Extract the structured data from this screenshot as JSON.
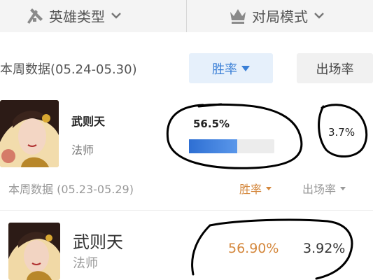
{
  "filters": {
    "hero_type": "英雄类型",
    "match_mode": "对局模式"
  },
  "section1": {
    "week_label": "本周数据(05.24-05.30)",
    "sort_winrate": "胜率",
    "sort_pickrate": "出场率",
    "hero": {
      "name": "武则天",
      "role": "法师",
      "win_rate_text": "56.5%",
      "win_rate_fraction": 0.565,
      "pick_rate_text": "3.7%"
    }
  },
  "section2": {
    "week_label": "本周数据 (05.23-05.29)",
    "sort_winrate": "胜率",
    "sort_pickrate": "出场率",
    "hero": {
      "name": "武则天",
      "role": "法师",
      "win_rate_text": "56.90%",
      "pick_rate_text": "3.92%"
    }
  },
  "colors": {
    "accent_blue": "#3a7fd6",
    "accent_orange": "#d4873c",
    "annotation_ink": "#000000"
  },
  "icons": [
    "hero-type-icon",
    "crown-icon",
    "chevron-down-icon",
    "sort-down-icon"
  ]
}
